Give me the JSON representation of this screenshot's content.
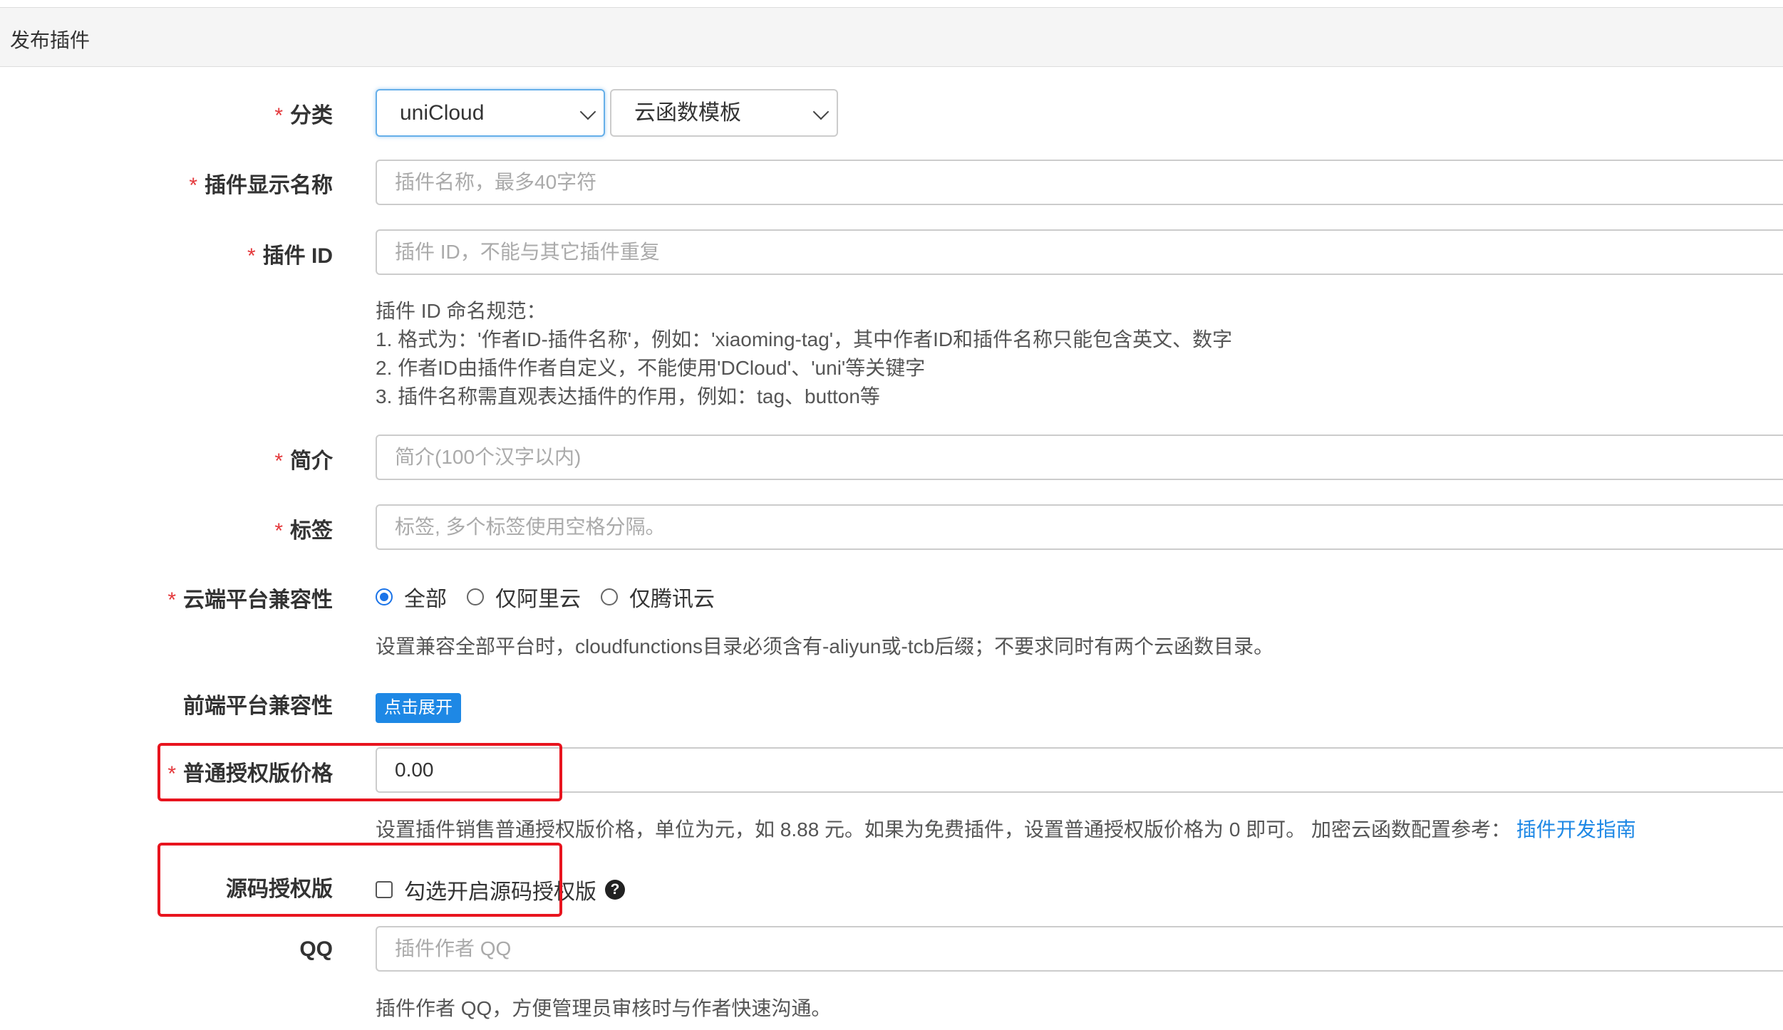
{
  "page": {
    "title": "发布插件"
  },
  "category": {
    "label": "分类",
    "primary": "uniCloud",
    "secondary": "云函数模板"
  },
  "display_name": {
    "label": "插件显示名称",
    "placeholder": "插件名称，最多40字符"
  },
  "plugin_id": {
    "label": "插件 ID",
    "placeholder": "插件 ID，不能与其它插件重复",
    "rules": [
      "插件 ID 命名规范：",
      "1. 格式为：'作者ID-插件名称'，例如：'xiaoming-tag'，其中作者ID和插件名称只能包含英文、数字",
      "2. 作者ID由插件作者自定义，不能使用'DCloud'、'uni'等关键字",
      "3. 插件名称需直观表达插件的作用，例如：tag、button等"
    ]
  },
  "intro": {
    "label": "简介",
    "placeholder": "简介(100个汉字以内)"
  },
  "tags": {
    "label": "标签",
    "placeholder": "标签, 多个标签使用空格分隔。"
  },
  "cloud_platform": {
    "label": "云端平台兼容性",
    "options": [
      "全部",
      "仅阿里云",
      "仅腾讯云"
    ],
    "selected": "全部",
    "help": "设置兼容全部平台时，cloudfunctions目录必须含有-aliyun或-tcb后缀；不要求同时有两个云函数目录。"
  },
  "frontend_platform": {
    "label": "前端平台兼容性",
    "button": "点击展开"
  },
  "price": {
    "label": "普通授权版价格",
    "value": "0.00",
    "help": "设置插件销售普通授权版价格，单位为元，如 8.88 元。如果为免费插件，设置普通授权版价格为 0 即可。 加密云函数配置参考：",
    "link": "插件开发指南"
  },
  "source_license": {
    "label": "源码授权版",
    "checkbox_label": "勾选开启源码授权版",
    "checked": false,
    "help_icon": "question-circle-icon"
  },
  "qq": {
    "label": "QQ",
    "placeholder": "插件作者 QQ",
    "help": "插件作者 QQ，方便管理员审核时与作者快速沟通。"
  },
  "required_mark": "*",
  "colors": {
    "accent": "#1e88e5",
    "required": "#e4393c",
    "highlight": "#e8141e"
  }
}
